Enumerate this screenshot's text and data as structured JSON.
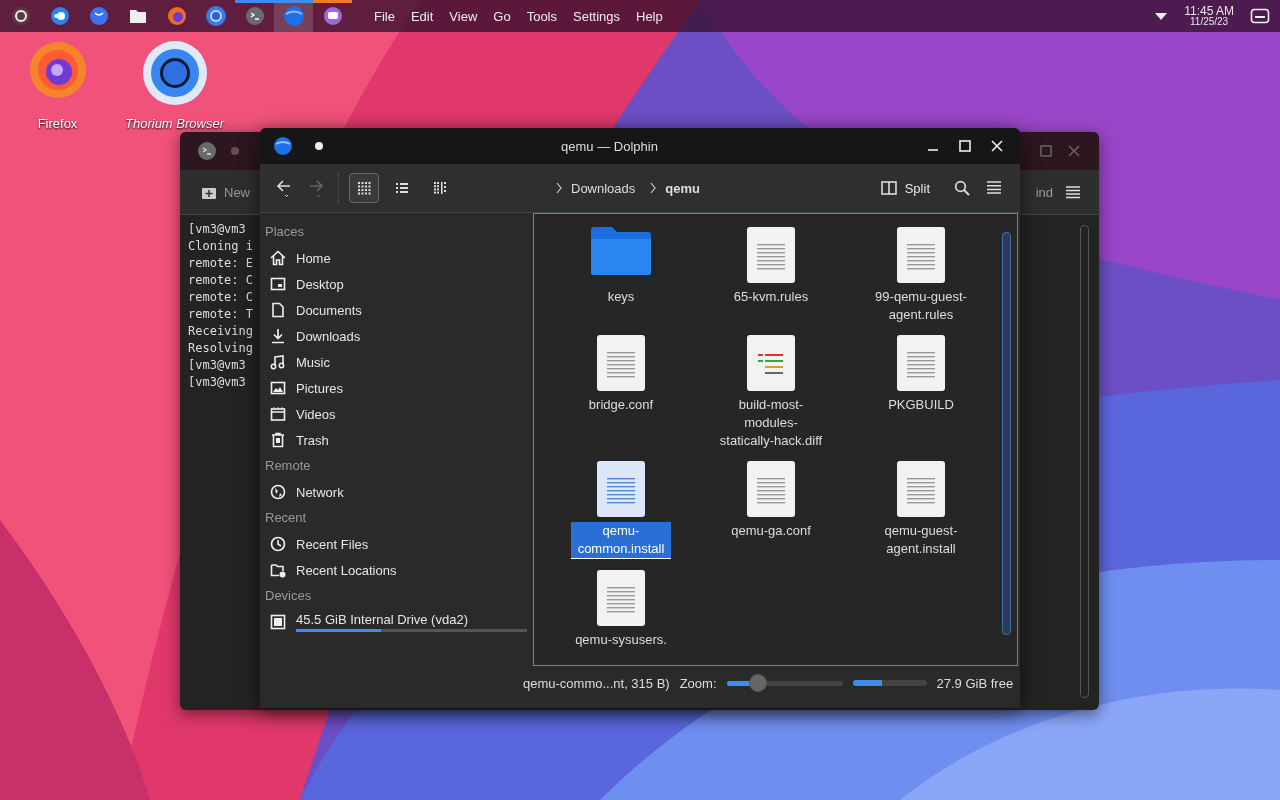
{
  "taskbar": {
    "tasks": [
      {
        "kind": "launcher",
        "selected": false
      },
      {
        "kind": "toggle",
        "selected": false
      },
      {
        "kind": "app-blue",
        "selected": false
      },
      {
        "kind": "files",
        "selected": false
      },
      {
        "kind": "firefox",
        "selected": false
      },
      {
        "kind": "thorium",
        "selected": false
      },
      {
        "kind": "terminal",
        "selected": false,
        "color": "#3d8ee8"
      },
      {
        "kind": "dolphin",
        "selected": true,
        "color": "#3d8ee8"
      },
      {
        "kind": "chat",
        "selected": false,
        "color": "#f07a2a"
      }
    ],
    "menu": [
      "File",
      "Edit",
      "View",
      "Go",
      "Tools",
      "Settings",
      "Help"
    ],
    "time": "11:45 AM",
    "date": "11/25/23"
  },
  "desktop_icons": [
    {
      "kind": "firefox",
      "label": "Firefox",
      "italic": false
    },
    {
      "kind": "thorium",
      "label": "Thorium Browser",
      "italic": true
    }
  ],
  "terminal": {
    "tab_button": "New",
    "find_button": "ind",
    "lines": [
      "[vm3@vm3",
      "Cloning i",
      "remote: E",
      "remote: C",
      "remote: C",
      "remote: T",
      "Receiving",
      "Resolving",
      "[vm3@vm3",
      "[vm3@vm3"
    ]
  },
  "dolphin": {
    "title": "qemu — Dolphin",
    "toolbar": {
      "back_disabled": false,
      "forward_disabled": true,
      "view_modes": [
        {
          "kind": "icons",
          "selected": true
        },
        {
          "kind": "compact",
          "selected": false
        },
        {
          "kind": "details",
          "selected": false
        }
      ],
      "breadcrumb": [
        {
          "label": "Downloads",
          "current": false
        },
        {
          "label": "qemu",
          "current": true
        }
      ],
      "split_button": "Split"
    },
    "sidebar": [
      {
        "title": "Places",
        "items": [
          {
            "kind": "home",
            "label": "Home",
            "selected": false
          },
          {
            "kind": "desktop",
            "label": "Desktop",
            "selected": false
          },
          {
            "kind": "documents",
            "label": "Documents",
            "selected": false
          },
          {
            "kind": "downloads",
            "label": "Downloads",
            "selected": false
          },
          {
            "kind": "music",
            "label": "Music",
            "selected": false
          },
          {
            "kind": "pictures",
            "label": "Pictures",
            "selected": false
          },
          {
            "kind": "videos",
            "label": "Videos",
            "selected": false
          },
          {
            "kind": "trash",
            "label": "Trash",
            "selected": false
          }
        ]
      },
      {
        "title": "Remote",
        "items": [
          {
            "kind": "network",
            "label": "Network",
            "selected": false
          }
        ]
      },
      {
        "title": "Recent",
        "items": [
          {
            "kind": "recent-files",
            "label": "Recent Files",
            "selected": false
          },
          {
            "kind": "recent-locations",
            "label": "Recent Locations",
            "selected": false
          }
        ]
      },
      {
        "title": "Devices",
        "items": [
          {
            "kind": "drive",
            "label": "45.5 GiB Internal Drive (vda2)",
            "selected": false,
            "level": 0.37
          }
        ]
      }
    ],
    "files": [
      {
        "kind": "folder",
        "name": "keys",
        "selected": false
      },
      {
        "kind": "text",
        "name": "65-kvm.rules",
        "selected": false
      },
      {
        "kind": "text",
        "name": "99-qemu-guest-agent.rules",
        "selected": false
      },
      {
        "kind": "text",
        "name": "bridge.conf",
        "selected": false
      },
      {
        "kind": "diff",
        "name": "build-most-modules-statically-hack.diff",
        "selected": false
      },
      {
        "kind": "text",
        "name": "PKGBUILD",
        "selected": false
      },
      {
        "kind": "text",
        "name": "qemu-common.install",
        "selected": true
      },
      {
        "kind": "text",
        "name": "qemu-ga.conf",
        "selected": false
      },
      {
        "kind": "text",
        "name": "qemu-guest-agent.install",
        "selected": false
      },
      {
        "kind": "text",
        "name": "qemu-sysusers.",
        "selected": false
      }
    ],
    "status": {
      "info": "qemu-commo...nt, 315 B)",
      "zoom_label": "Zoom:",
      "zoom": {
        "level": 0.27
      },
      "space": {
        "level": 0.4
      },
      "free": "27.9 GiB free"
    }
  }
}
